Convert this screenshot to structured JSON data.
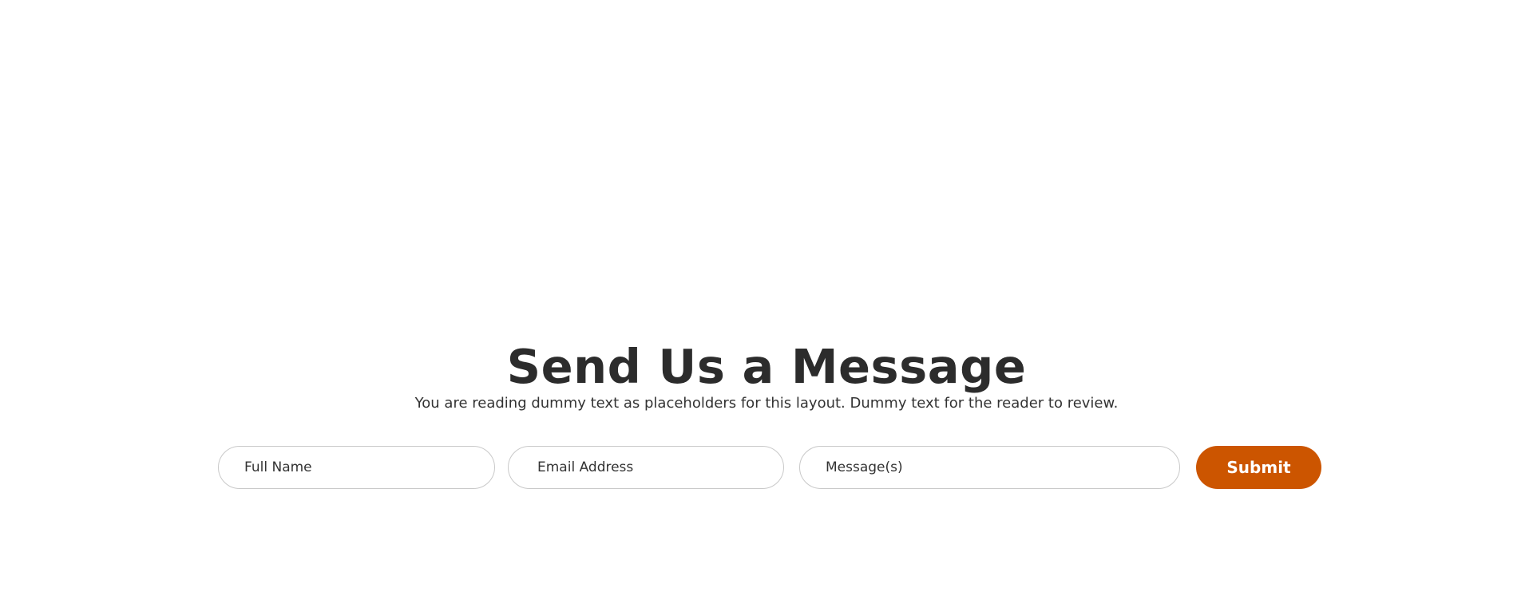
{
  "contact": {
    "title": "Send Us a Message",
    "subtitle": "You are reading dummy text as placeholders for this layout. Dummy text for the reader to review."
  },
  "form": {
    "name_placeholder": "Full Name",
    "email_placeholder": "Email Address",
    "message_placeholder": "Message(s)",
    "submit_label": "Submit"
  },
  "colors": {
    "accent": "#cc5500",
    "text": "#2c2c2c",
    "field_border": "#c9c9c9"
  }
}
